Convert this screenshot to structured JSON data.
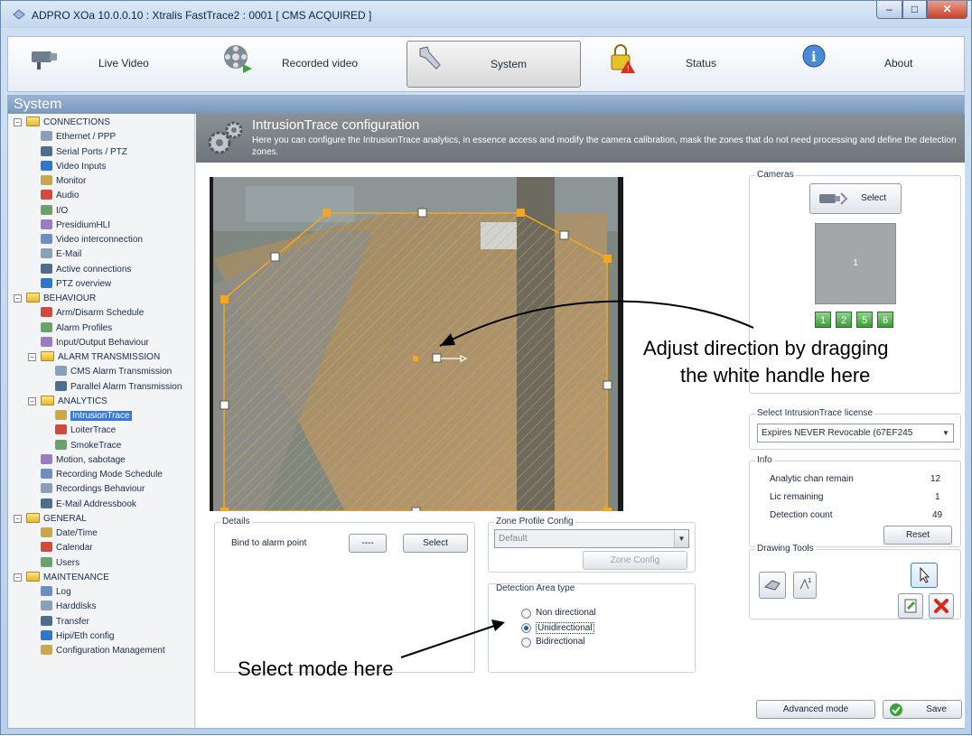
{
  "window": {
    "title": "ADPRO XOa 10.0.0.10 : Xtralis FastTrace2 : 0001 [ CMS ACQUIRED ]"
  },
  "navbar": [
    {
      "label": "Live Video",
      "icon": "camera-icon"
    },
    {
      "label": "Recorded video",
      "icon": "film-reel-icon"
    },
    {
      "label": "System",
      "icon": "wrench-icon",
      "active": true
    },
    {
      "label": "Status",
      "icon": "alarm-lock-icon"
    },
    {
      "label": "About",
      "icon": "info-icon"
    }
  ],
  "panel": {
    "title": "System"
  },
  "tree": {
    "connections": {
      "label": "CONNECTIONS",
      "items": [
        "Ethernet / PPP",
        "Serial Ports / PTZ",
        "Video Inputs",
        "Monitor",
        "Audio",
        "I/O",
        "PresidiumHLI",
        "Video interconnection",
        "E-Mail",
        "Active connections",
        "PTZ overview"
      ]
    },
    "behaviour": {
      "label": "BEHAVIOUR",
      "items": [
        "Arm/Disarm Schedule",
        "Alarm Profiles",
        "Input/Output Behaviour"
      ]
    },
    "alarm_transmission": {
      "label": "ALARM TRANSMISSION",
      "items": [
        "CMS Alarm Transmission",
        "Parallel Alarm Transmission"
      ]
    },
    "analytics": {
      "label": "ANALYTICS",
      "items": [
        "IntrusionTrace",
        "LoiterTrace",
        "SmokeTrace"
      ]
    },
    "behaviour_more": [
      "Motion, sabotage",
      "Recording Mode Schedule",
      "Recordings Behaviour",
      "E-Mail Addressbook"
    ],
    "general": {
      "label": "GENERAL",
      "items": [
        "Date/Time",
        "Calendar",
        "Users"
      ]
    },
    "maintenance": {
      "label": "MAINTENANCE",
      "items": [
        "Log",
        "Harddisks",
        "Transfer",
        "Hipi/Eth config",
        "Configuration Management"
      ]
    }
  },
  "config": {
    "title": "IntrusionTrace configuration",
    "description": "Here you can configure the IntrusionTrace analytics, in essence access and modify the camera calibration, mask the zones that do not need processing and define the detection zones."
  },
  "details": {
    "title": "Details",
    "bind_label": "Bind to alarm point",
    "bind_value": "----",
    "select_label": "Select"
  },
  "zone_profile": {
    "title": "Zone Profile Config",
    "value": "Default",
    "zone_config_label": "Zone Config"
  },
  "detection_area": {
    "title": "Detection Area type",
    "options": [
      "Non directional",
      "Unidirectional",
      "Bidirectional"
    ],
    "selected": "Unidirectional"
  },
  "cameras": {
    "title": "Cameras",
    "select_label": "Select",
    "preview_label": "1",
    "badges": [
      "1",
      "2",
      "5",
      "6"
    ]
  },
  "license": {
    "title": "Select IntrusionTrace license",
    "value": "Expires NEVER Revocable (67EF245"
  },
  "info": {
    "title": "Info",
    "rows": [
      {
        "label": "Analytic chan remain",
        "value": "12"
      },
      {
        "label": "Lic remaining",
        "value": "1"
      },
      {
        "label": "Detection count",
        "value": "49"
      }
    ],
    "reset_label": "Reset"
  },
  "drawing_tools": {
    "title": "Drawing Tools"
  },
  "footer": {
    "advanced_label": "Advanced mode",
    "save_label": "Save"
  },
  "annotations": {
    "direction": [
      "Adjust direction by dragging",
      "the white handle here"
    ],
    "mode": "Select mode here"
  },
  "colors": {
    "zone": "#f5a623",
    "accent": "#3a78d8",
    "header": "#7896bd"
  }
}
